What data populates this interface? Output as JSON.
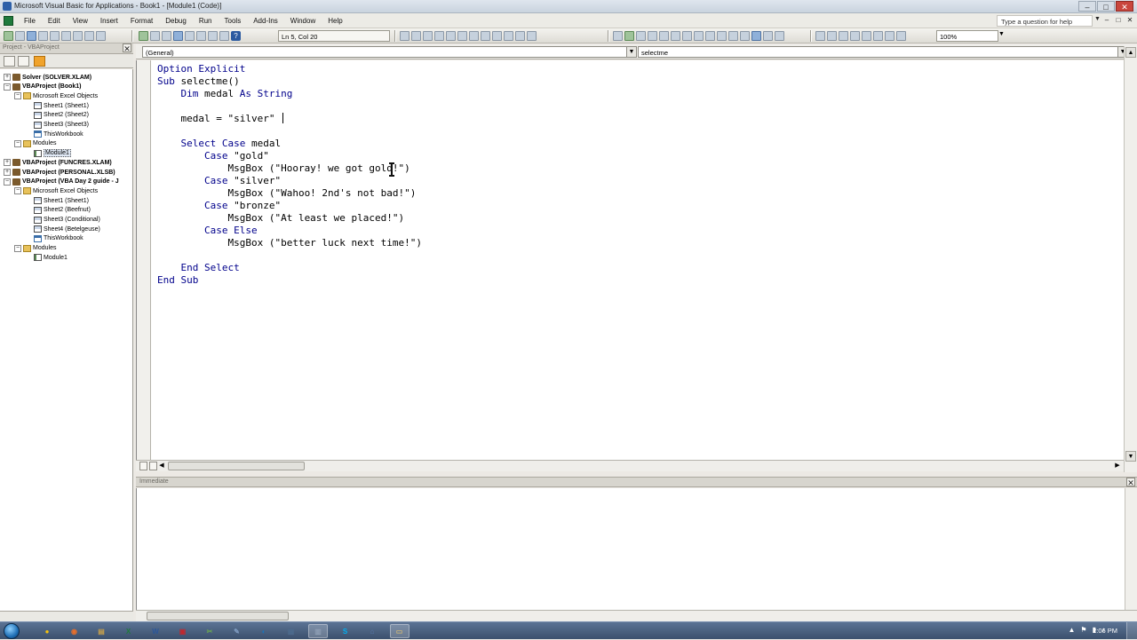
{
  "window": {
    "title": "Microsoft Visual Basic for Applications - Book1 - [Module1 (Code)]",
    "controls": [
      "–",
      "□",
      "✕"
    ]
  },
  "menubar": {
    "items": [
      "File",
      "Edit",
      "View",
      "Insert",
      "Format",
      "Debug",
      "Run",
      "Tools",
      "Add-Ins",
      "Window",
      "Help"
    ],
    "ask_placeholder": "Type a question for help",
    "mdi_controls": [
      "–",
      "□",
      "✕"
    ]
  },
  "toolbar": {
    "position": "Ln 5, Col 20",
    "zoom": "100%"
  },
  "project_explorer": {
    "title": "Project - VBAProject",
    "close": "✕",
    "tree": [
      {
        "label": "Solver (SOLVER.XLAM)",
        "type": "project",
        "level": 0,
        "expander": "+",
        "bold": true
      },
      {
        "label": "VBAProject (Book1)",
        "type": "project",
        "level": 0,
        "expander": "−",
        "bold": true
      },
      {
        "label": "Microsoft Excel Objects",
        "type": "folder",
        "level": 1,
        "expander": "−"
      },
      {
        "label": "Sheet1 (Sheet1)",
        "type": "sheet",
        "level": 2
      },
      {
        "label": "Sheet2 (Sheet2)",
        "type": "sheet",
        "level": 2
      },
      {
        "label": "Sheet3 (Sheet3)",
        "type": "sheet",
        "level": 2
      },
      {
        "label": "ThisWorkbook",
        "type": "workbook",
        "level": 2
      },
      {
        "label": "Modules",
        "type": "folder",
        "level": 1,
        "expander": "−"
      },
      {
        "label": "Module1",
        "type": "module",
        "level": 2,
        "selected": true
      },
      {
        "label": "VBAProject (FUNCRES.XLAM)",
        "type": "project",
        "level": 0,
        "expander": "+",
        "bold": true
      },
      {
        "label": "VBAProject (PERSONAL.XLSB)",
        "type": "project",
        "level": 0,
        "expander": "+",
        "bold": true
      },
      {
        "label": "VBAProject (VBA Day 2 guide - J",
        "type": "project",
        "level": 0,
        "expander": "−",
        "bold": true
      },
      {
        "label": "Microsoft Excel Objects",
        "type": "folder",
        "level": 1,
        "expander": "−"
      },
      {
        "label": "Sheet1 (Sheet1)",
        "type": "sheet",
        "level": 2
      },
      {
        "label": "Sheet2 (Beefnut)",
        "type": "sheet",
        "level": 2
      },
      {
        "label": "Sheet3 (Conditional)",
        "type": "sheet",
        "level": 2
      },
      {
        "label": "Sheet4 (Betelgeuse)",
        "type": "sheet",
        "level": 2
      },
      {
        "label": "ThisWorkbook",
        "type": "workbook",
        "level": 2
      },
      {
        "label": "Modules",
        "type": "folder",
        "level": 1,
        "expander": "−"
      },
      {
        "label": "Module1",
        "type": "module",
        "level": 2
      }
    ]
  },
  "code_window": {
    "object_combo": "(General)",
    "proc_combo": "selectme",
    "lines": [
      "Option Explicit",
      "Sub selectme()",
      "    Dim medal As String",
      "",
      "    medal = \"silver\"",
      "",
      "    Select Case medal",
      "        Case \"gold\"",
      "            MsgBox (\"Hooray! we got gold!\")",
      "        Case \"silver\"",
      "            MsgBox (\"Wahoo! 2nd's not bad!\")",
      "        Case \"bronze\"",
      "            MsgBox (\"At least we placed!\")",
      "        Case Else",
      "            MsgBox (\"better luck next time!\")",
      "",
      "    End Select",
      "End Sub"
    ]
  },
  "immediate": {
    "title": "Immediate",
    "close": "✕"
  },
  "taskbar": {
    "apps": [
      "Chrome",
      "Firefox",
      "Explorer",
      "Excel",
      "Word",
      "PDF",
      "Snipping",
      "Paint",
      "Outlook",
      "Calculator",
      "VBA",
      "Skype",
      "Remote",
      "Notes"
    ],
    "tray_icons": [
      "▲",
      "⚑",
      "▮",
      "♪"
    ],
    "clock": "2:06 PM"
  },
  "colors": {
    "keyword": "#00008b",
    "accent": "#f0a32c",
    "taskbar": "#3b506d"
  }
}
